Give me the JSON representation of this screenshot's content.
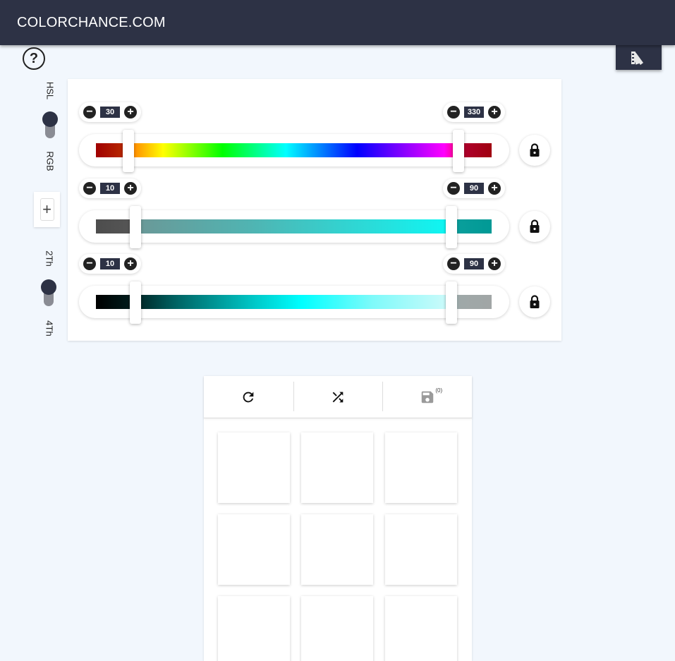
{
  "header": {
    "title": "COLORCHANCE.COM"
  },
  "help": {
    "label": "?"
  },
  "side": {
    "mode_top_label": "HSL",
    "mode_bottom_label": "RGB",
    "mode_selected": "HSL",
    "add_label": "+",
    "count_top_label": "2Th",
    "count_bottom_label": "4Th",
    "count_selected": "2Th"
  },
  "sliders": [
    {
      "name": "hue",
      "min_value": "30",
      "max_value": "330",
      "min_fraction": 0.083,
      "max_fraction": 0.917,
      "locked": true
    },
    {
      "name": "saturation",
      "min_value": "10",
      "max_value": "90",
      "min_fraction": 0.1,
      "max_fraction": 0.9,
      "locked": true
    },
    {
      "name": "lightness",
      "min_value": "10",
      "max_value": "90",
      "min_fraction": 0.1,
      "max_fraction": 0.9,
      "locked": true
    }
  ],
  "results": {
    "toolbar": {
      "refresh_icon": "refresh-icon",
      "shuffle_icon": "shuffle-icon",
      "save_icon": "save-icon",
      "save_count": "(0)"
    }
  },
  "colors": {
    "header_bg": "#2d3245",
    "page_bg": "#f2f7fd",
    "accent": "#2d3245"
  }
}
